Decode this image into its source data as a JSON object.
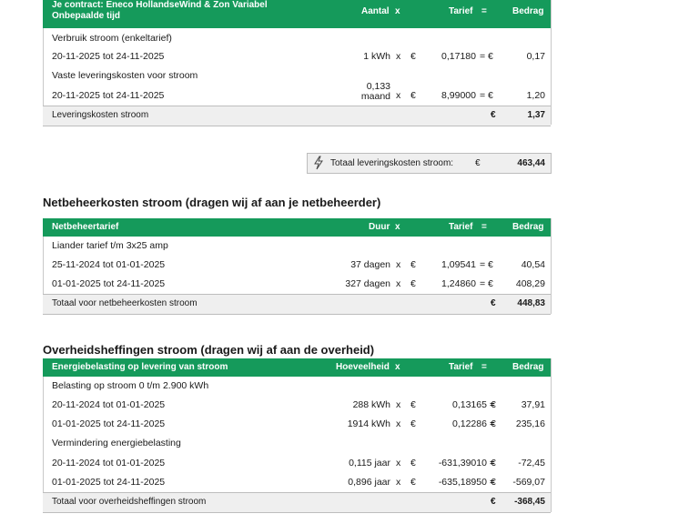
{
  "supply": {
    "header": {
      "contract_line1": "Je contract:  Eneco HollandseWind & Zon Variabel",
      "contract_line2": "Onbepaalde tijd",
      "col_amount": "Aantal",
      "col_x": "x",
      "col_rate": "Tarief",
      "col_eq": "=",
      "col_total": "Bedrag"
    },
    "sub1": "Verbruik stroom (enkeltarief)",
    "row1": {
      "period": "20-11-2025 tot 24-11-2025",
      "qty": "1 kWh",
      "x": "x",
      "cur": "€",
      "rate": "0,17180",
      "eq": "= €",
      "amount": "0,17"
    },
    "sub2": "Vaste leveringskosten voor stroom",
    "row2": {
      "period": "20-11-2025 tot 24-11-2025",
      "qty": "0,133",
      "qty_unit": "maand",
      "x": "x",
      "cur": "€",
      "rate": "8,99000",
      "eq": "= €",
      "amount": "1,20"
    },
    "total": {
      "label": "Leveringskosten stroom",
      "cur": "€",
      "amount": "1,37"
    }
  },
  "grand_total": {
    "label": "Totaal leveringskosten stroom:",
    "cur": "€",
    "amount": "463,44"
  },
  "network": {
    "title": "Netbeheerkosten stroom (dragen wij af aan je netbeheerder)",
    "header": {
      "label": "Netbeheertarief",
      "col_duration": "Duur",
      "col_x": "x",
      "col_rate": "Tarief",
      "col_eq": "=",
      "col_total": "Bedrag"
    },
    "sub1": "Liander tarief t/m 3x25 amp",
    "rows": [
      {
        "period": "25-11-2024 tot 01-01-2025",
        "qty": "37 dagen",
        "x": "x",
        "cur": "€",
        "rate": "1,09541",
        "eq": "= €",
        "amount": "40,54"
      },
      {
        "period": "01-01-2025 tot 24-11-2025",
        "qty": "327 dagen",
        "x": "x",
        "cur": "€",
        "rate": "1,24860",
        "eq": "= €",
        "amount": "408,29"
      }
    ],
    "total": {
      "label": "Totaal voor netbeheerkosten stroom",
      "cur": "€",
      "amount": "448,83"
    }
  },
  "tax": {
    "title": "Overheidsheffingen stroom (dragen wij af aan de overheid)",
    "header": {
      "label": "Energiebelasting op levering van stroom",
      "col_qty": "Hoeveelheid",
      "col_x": "x",
      "col_rate": "Tarief",
      "col_eq": "=",
      "col_total": "Bedrag"
    },
    "sub1": "Belasting op stroom  0 t/m 2.900 kWh",
    "rows1": [
      {
        "period": "20-11-2024 tot 01-01-2025",
        "qty": "288 kWh",
        "x": "x",
        "cur": "€",
        "rate": "0,13165 =",
        "eq": "€",
        "amount": "37,91"
      },
      {
        "period": "01-01-2025 tot 24-11-2025",
        "qty": "1914 kWh",
        "x": "x",
        "cur": "€",
        "rate": "0,12286 =",
        "eq": "€",
        "amount": "235,16"
      }
    ],
    "sub2": "Vermindering energiebelasting",
    "rows2": [
      {
        "period": "20-11-2024 tot 01-01-2025",
        "qty": "0,115 jaar",
        "x": "x",
        "cur": "€",
        "rate": "-631,39010 =",
        "eq": "€",
        "amount": "-72,45"
      },
      {
        "period": "01-01-2025 tot 24-11-2025",
        "qty": "0,896 jaar",
        "x": "x",
        "cur": "€",
        "rate": "-635,18950 =",
        "eq": "€",
        "amount": "-569,07"
      }
    ],
    "total": {
      "label": "Totaal voor overheidsheffingen stroom",
      "cur": "€",
      "amount": "-368,45"
    }
  }
}
